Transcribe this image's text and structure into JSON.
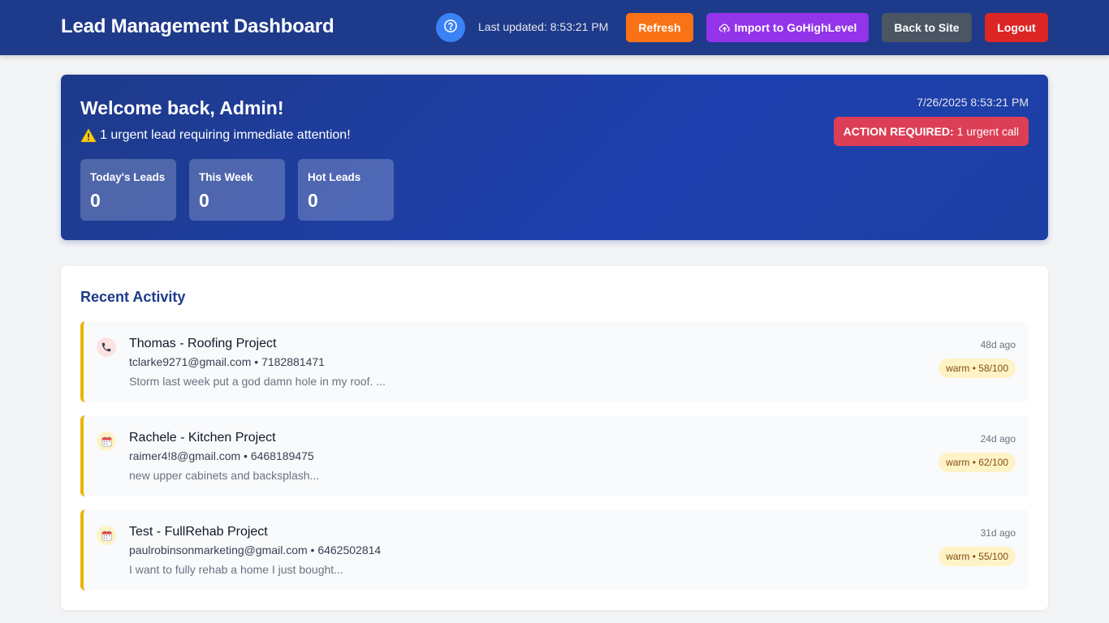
{
  "header": {
    "title": "Lead Management Dashboard",
    "help_icon": "question-circle-icon",
    "last_updated": "Last updated: 8:53:21 PM",
    "refresh_label": "Refresh",
    "import_icon": "cloud-upload-icon",
    "import_label": "Import to GoHighLevel",
    "back_label": "Back to Site",
    "logout_label": "Logout"
  },
  "welcome": {
    "title": "Welcome back, Admin!",
    "warning_icon": "warning-icon",
    "urgent_text": "1 urgent lead requiring immediate attention!",
    "datetime": "7/26/2025 8:53:21 PM",
    "action_prefix": "ACTION REQUIRED:",
    "action_text": "1 urgent call",
    "stats": [
      {
        "label": "Today's Leads",
        "value": "0"
      },
      {
        "label": "This Week",
        "value": "0"
      },
      {
        "label": "Hot Leads",
        "value": "0"
      }
    ]
  },
  "activity": {
    "title": "Recent Activity",
    "items": [
      {
        "icon": "phone-icon",
        "name": "Thomas - Roofing Project",
        "contact": "tclarke9271@gmail.com • 7182881471",
        "message": "Storm last week put a god damn hole in my roof. ...",
        "time": "48d ago",
        "badge": "warm • 58/100"
      },
      {
        "icon": "calendar-icon",
        "name": "Rachele - Kitchen Project",
        "contact": "raimer4!8@gmail.com • 6468189475",
        "message": "new upper cabinets and backsplash...",
        "time": "24d ago",
        "badge": "warm • 62/100"
      },
      {
        "icon": "calendar-icon",
        "name": "Test - FullRehab Project",
        "contact": "paulrobinsonmarketing@gmail.com • 6462502814",
        "message": "I want to fully rehab a home I just bought...",
        "time": "31d ago",
        "badge": "warm • 55/100"
      }
    ]
  },
  "colors": {
    "header_bg": "#1e3a8a",
    "refresh": "#f97316",
    "import": "#9333ea",
    "back": "#4b5563",
    "logout": "#dc2626",
    "warm_accent": "#eab308"
  }
}
